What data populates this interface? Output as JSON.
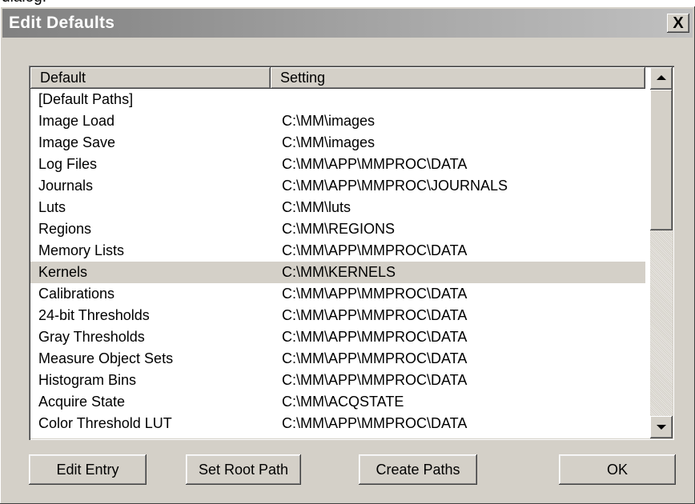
{
  "caption": "dialog.",
  "window": {
    "title": "Edit Defaults",
    "close_label": "X"
  },
  "list": {
    "columns": [
      "Default",
      "Setting"
    ],
    "rows": [
      {
        "default": "[Default Paths]",
        "setting": ""
      },
      {
        "default": "Image Load",
        "setting": "C:\\MM\\images"
      },
      {
        "default": "Image Save",
        "setting": "C:\\MM\\images"
      },
      {
        "default": "Log Files",
        "setting": "C:\\MM\\APP\\MMPROC\\DATA"
      },
      {
        "default": "Journals",
        "setting": "C:\\MM\\APP\\MMPROC\\JOURNALS"
      },
      {
        "default": "Luts",
        "setting": "C:\\MM\\luts"
      },
      {
        "default": "Regions",
        "setting": "C:\\MM\\REGIONS"
      },
      {
        "default": "Memory Lists",
        "setting": "C:\\MM\\APP\\MMPROC\\DATA"
      },
      {
        "default": "Kernels",
        "setting": "C:\\MM\\KERNELS"
      },
      {
        "default": "Calibrations",
        "setting": "C:\\MM\\APP\\MMPROC\\DATA"
      },
      {
        "default": "24-bit Thresholds",
        "setting": "C:\\MM\\APP\\MMPROC\\DATA"
      },
      {
        "default": "Gray Thresholds",
        "setting": "C:\\MM\\APP\\MMPROC\\DATA"
      },
      {
        "default": "Measure Object Sets",
        "setting": "C:\\MM\\APP\\MMPROC\\DATA"
      },
      {
        "default": "Histogram Bins",
        "setting": "C:\\MM\\APP\\MMPROC\\DATA"
      },
      {
        "default": "Acquire State",
        "setting": "C:\\MM\\ACQSTATE"
      },
      {
        "default": "Color Threshold LUT",
        "setting": "C:\\MM\\APP\\MMPROC\\DATA"
      }
    ],
    "selected_index": 8
  },
  "buttons": {
    "edit_entry": "Edit Entry",
    "set_root_path": "Set Root Path",
    "create_paths": "Create Paths",
    "ok": "OK"
  }
}
